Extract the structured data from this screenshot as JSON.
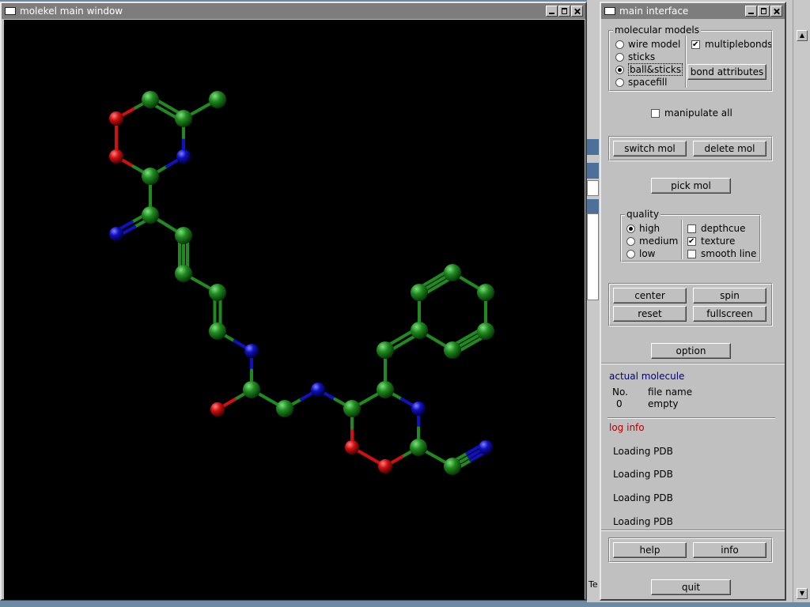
{
  "mol_window": {
    "title": "molekel main window"
  },
  "bg_window": {
    "partial_text": "Te"
  },
  "interface": {
    "title": "main interface",
    "molecular_models": {
      "legend": "molecular models",
      "options": [
        "wire model",
        "sticks",
        "ball&sticks",
        "spacefill"
      ],
      "selected": "ball&sticks",
      "multiplebonds_label": "multiplebonds",
      "multiplebonds_checked": true,
      "bond_attributes_label": "bond attributes"
    },
    "manipulate_all_label": "manipulate all",
    "manipulate_all_checked": false,
    "switch_mol_label": "switch mol",
    "delete_mol_label": "delete mol",
    "pick_mol_label": "pick mol",
    "quality": {
      "legend": "quality",
      "options": [
        "high",
        "medium",
        "low"
      ],
      "selected": "high",
      "depthcue_label": "depthcue",
      "depthcue_checked": false,
      "texture_label": "texture",
      "texture_checked": true,
      "smooth_line_label": "smooth line",
      "smooth_line_checked": false
    },
    "center_label": "center",
    "spin_label": "spin",
    "reset_label": "reset",
    "fullscreen_label": "fullscreen",
    "option_label": "option",
    "actual_molecule": {
      "title": "actual molecule",
      "col_no": "No.",
      "col_file": "file name",
      "row_no": "0",
      "row_file": "empty"
    },
    "log": {
      "title": "log info",
      "entries": [
        "Loading PDB",
        "Loading PDB",
        "Loading PDB",
        "Loading PDB"
      ]
    },
    "help_label": "help",
    "info_label": "info",
    "quit_label": "quit"
  },
  "colors": {
    "carbon": "#1f8a1f",
    "oxygen": "#d01010",
    "nitrogen": "#1010c0",
    "actual_molecule_title": "#000080",
    "log_title": "#b00000"
  }
}
